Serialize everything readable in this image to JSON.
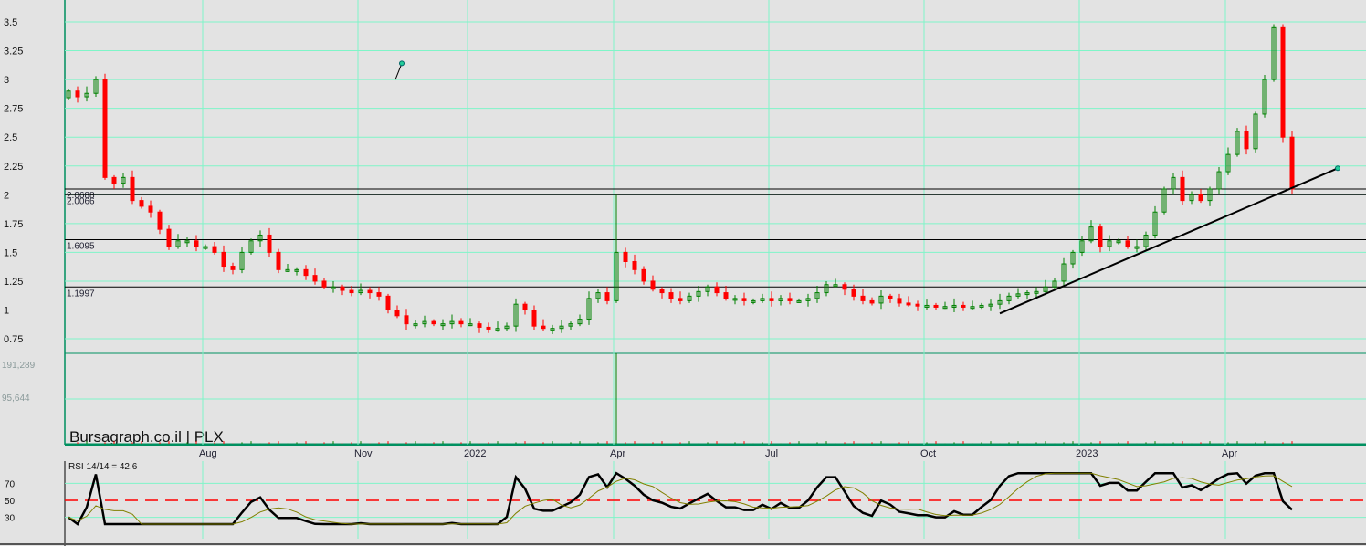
{
  "chart_data": {
    "type": "candlestick",
    "title": "Bursagraph.co.il | PLX",
    "watermark": "Bursagraph.co.il | PLX",
    "y_ticks": [
      "3.5",
      "3.25",
      "3",
      "2.75",
      "2.5",
      "2.25",
      "2",
      "1.75",
      "1.5",
      "1.25",
      "1",
      "0.75"
    ],
    "y_tick_values": [
      3.5,
      3.25,
      3,
      2.75,
      2.5,
      2.25,
      2,
      1.75,
      1.5,
      1.25,
      1,
      0.75
    ],
    "ylim": [
      0.7,
      3.55
    ],
    "x_labels": [
      "Aug",
      "Nov",
      "2022",
      "Apr",
      "Jul",
      "Oct",
      "2023",
      "Apr"
    ],
    "x_label_index": [
      15,
      32,
      44,
      60,
      77,
      94,
      111,
      127
    ],
    "closes": [
      2.9,
      2.85,
      2.88,
      3.0,
      2.15,
      2.1,
      2.15,
      1.95,
      1.9,
      1.85,
      1.7,
      1.55,
      1.6,
      1.6,
      1.55,
      1.55,
      1.5,
      1.38,
      1.35,
      1.5,
      1.6,
      1.65,
      1.5,
      1.35,
      1.35,
      1.35,
      1.3,
      1.25,
      1.2,
      1.2,
      1.17,
      1.15,
      1.17,
      1.15,
      1.12,
      1.0,
      0.95,
      0.88,
      0.88,
      0.9,
      0.88,
      0.88,
      0.9,
      0.88,
      0.88,
      0.85,
      0.84,
      0.84,
      0.86,
      1.05,
      1.0,
      0.86,
      0.84,
      0.84,
      0.86,
      0.88,
      0.92,
      1.1,
      1.15,
      1.08,
      1.5,
      1.42,
      1.35,
      1.25,
      1.18,
      1.15,
      1.1,
      1.08,
      1.12,
      1.16,
      1.2,
      1.15,
      1.1,
      1.1,
      1.08,
      1.08,
      1.1,
      1.08,
      1.1,
      1.08,
      1.08,
      1.1,
      1.15,
      1.22,
      1.22,
      1.18,
      1.12,
      1.08,
      1.06,
      1.12,
      1.1,
      1.06,
      1.05,
      1.04,
      1.04,
      1.03,
      1.03,
      1.04,
      1.03,
      1.03,
      1.04,
      1.05,
      1.08,
      1.12,
      1.14,
      1.15,
      1.16,
      1.2,
      1.25,
      1.4,
      1.5,
      1.6,
      1.72,
      1.55,
      1.6,
      1.6,
      1.55,
      1.55,
      1.65,
      1.85,
      2.05,
      2.15,
      1.95,
      2.0,
      1.95,
      2.05,
      2.2,
      2.35,
      2.55,
      2.4,
      2.7,
      3.0,
      3.45,
      2.5,
      2.05
    ],
    "high_overrides": [
      {
        "index": 60,
        "high": 2.0
      },
      {
        "index": 132,
        "high": 3.48
      }
    ],
    "fib_levels": [
      {
        "label": "2.0688",
        "value": 2.05
      },
      {
        "label": "2.0066",
        "value": 2.0
      },
      {
        "label": "1.6095",
        "value": 1.61
      },
      {
        "label": "1.1997",
        "value": 1.2
      }
    ],
    "trendline": {
      "from": {
        "index": 102,
        "value": 0.97
      },
      "to": {
        "index": 139,
        "value": 2.23
      }
    },
    "small_marker": {
      "from": {
        "index": 36,
        "value": 3.0
      },
      "to": {
        "index": 36.4,
        "value": 3.14
      }
    },
    "volume": {
      "ticks": [
        "191,289",
        "95,644"
      ],
      "tick_values": [
        191289,
        95644
      ],
      "baseline": 2500,
      "spike": {
        "index": 60,
        "value": 191289
      }
    },
    "rsi": {
      "label": "RSI 14/14 = 42.6",
      "ticks": [
        "70",
        "50",
        "30"
      ],
      "tick_values": [
        70,
        50,
        30
      ],
      "reference": 50
    },
    "colors": {
      "up": "#008000",
      "down": "#ff0000",
      "grid": "#7ff5c8",
      "rsi": "#000000",
      "rsi_ma": "#808000",
      "ref": "#ff0000",
      "frame": "#009060"
    }
  }
}
